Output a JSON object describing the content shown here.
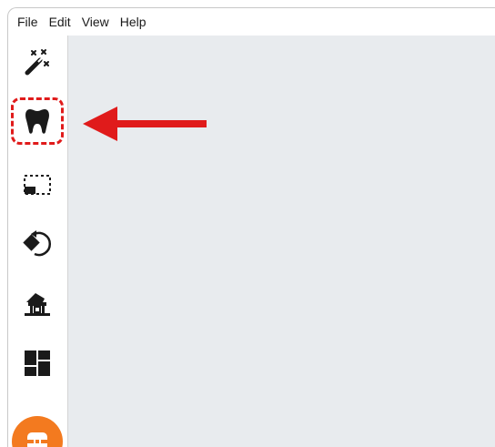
{
  "menu": {
    "file": "File",
    "edit": "Edit",
    "view": "View",
    "help": "Help"
  },
  "toolbar": {
    "tools": [
      {
        "icon": "magic-wand-icon"
      },
      {
        "icon": "tooth-icon",
        "highlighted": true
      },
      {
        "icon": "selection-rect-icon"
      },
      {
        "icon": "rotate-icon"
      },
      {
        "icon": "scanner-icon"
      },
      {
        "icon": "layout-grid-icon"
      },
      {
        "icon": "orange-action-icon"
      }
    ]
  },
  "colors": {
    "highlight": "#e01b1b",
    "arrow": "#e01b1b",
    "orange": "#f37a1f",
    "canvas": "#e8ebee"
  }
}
